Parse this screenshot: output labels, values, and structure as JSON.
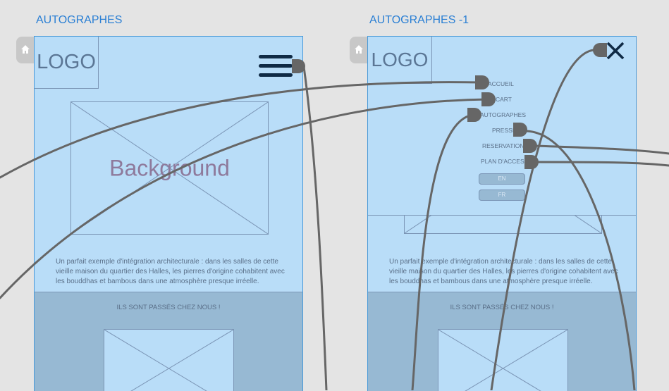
{
  "artboards": [
    {
      "title": "AUTOGRAPHES",
      "logo": "LOGO",
      "hero_label": "Background",
      "description": "Un parfait exemple d'intégration architecturale : dans les salles de cette vieille maison du quartier des Halles, les pierres d'origine cohabitent avec les bouddhas et bambous dans une atmosphère presque irréelle.",
      "band_title": "ILS SONT PASSÉS CHEZ NOUS !",
      "menu_icon": "hamburger-menu-icon"
    },
    {
      "title": "AUTOGRAPHES -1",
      "logo": "LOGO",
      "description": "Un parfait exemple d'intégration architecturale : dans les salles de cette vieille maison du quartier des Halles, les pierres d'origine cohabitent avec les bouddhas et bambous dans une atmosphère presque irréelle.",
      "band_title": "ILS SONT PASSÉS CHEZ NOUS !",
      "close_icon": "close-icon",
      "menu": [
        "ACCUEIL",
        "CART",
        "AUTOGRAPHES",
        "PRESSE",
        "RESERVATION",
        "PLAN D'ACCES"
      ],
      "languages": [
        "EN",
        "FR"
      ]
    }
  ],
  "colors": {
    "background": "#e4e4e4",
    "frame_fill": "#b9ddf8",
    "frame_border": "#4a9ad8",
    "band_fill": "#97b9d3",
    "title_blue": "#2a7fd4",
    "connector": "#666666"
  }
}
